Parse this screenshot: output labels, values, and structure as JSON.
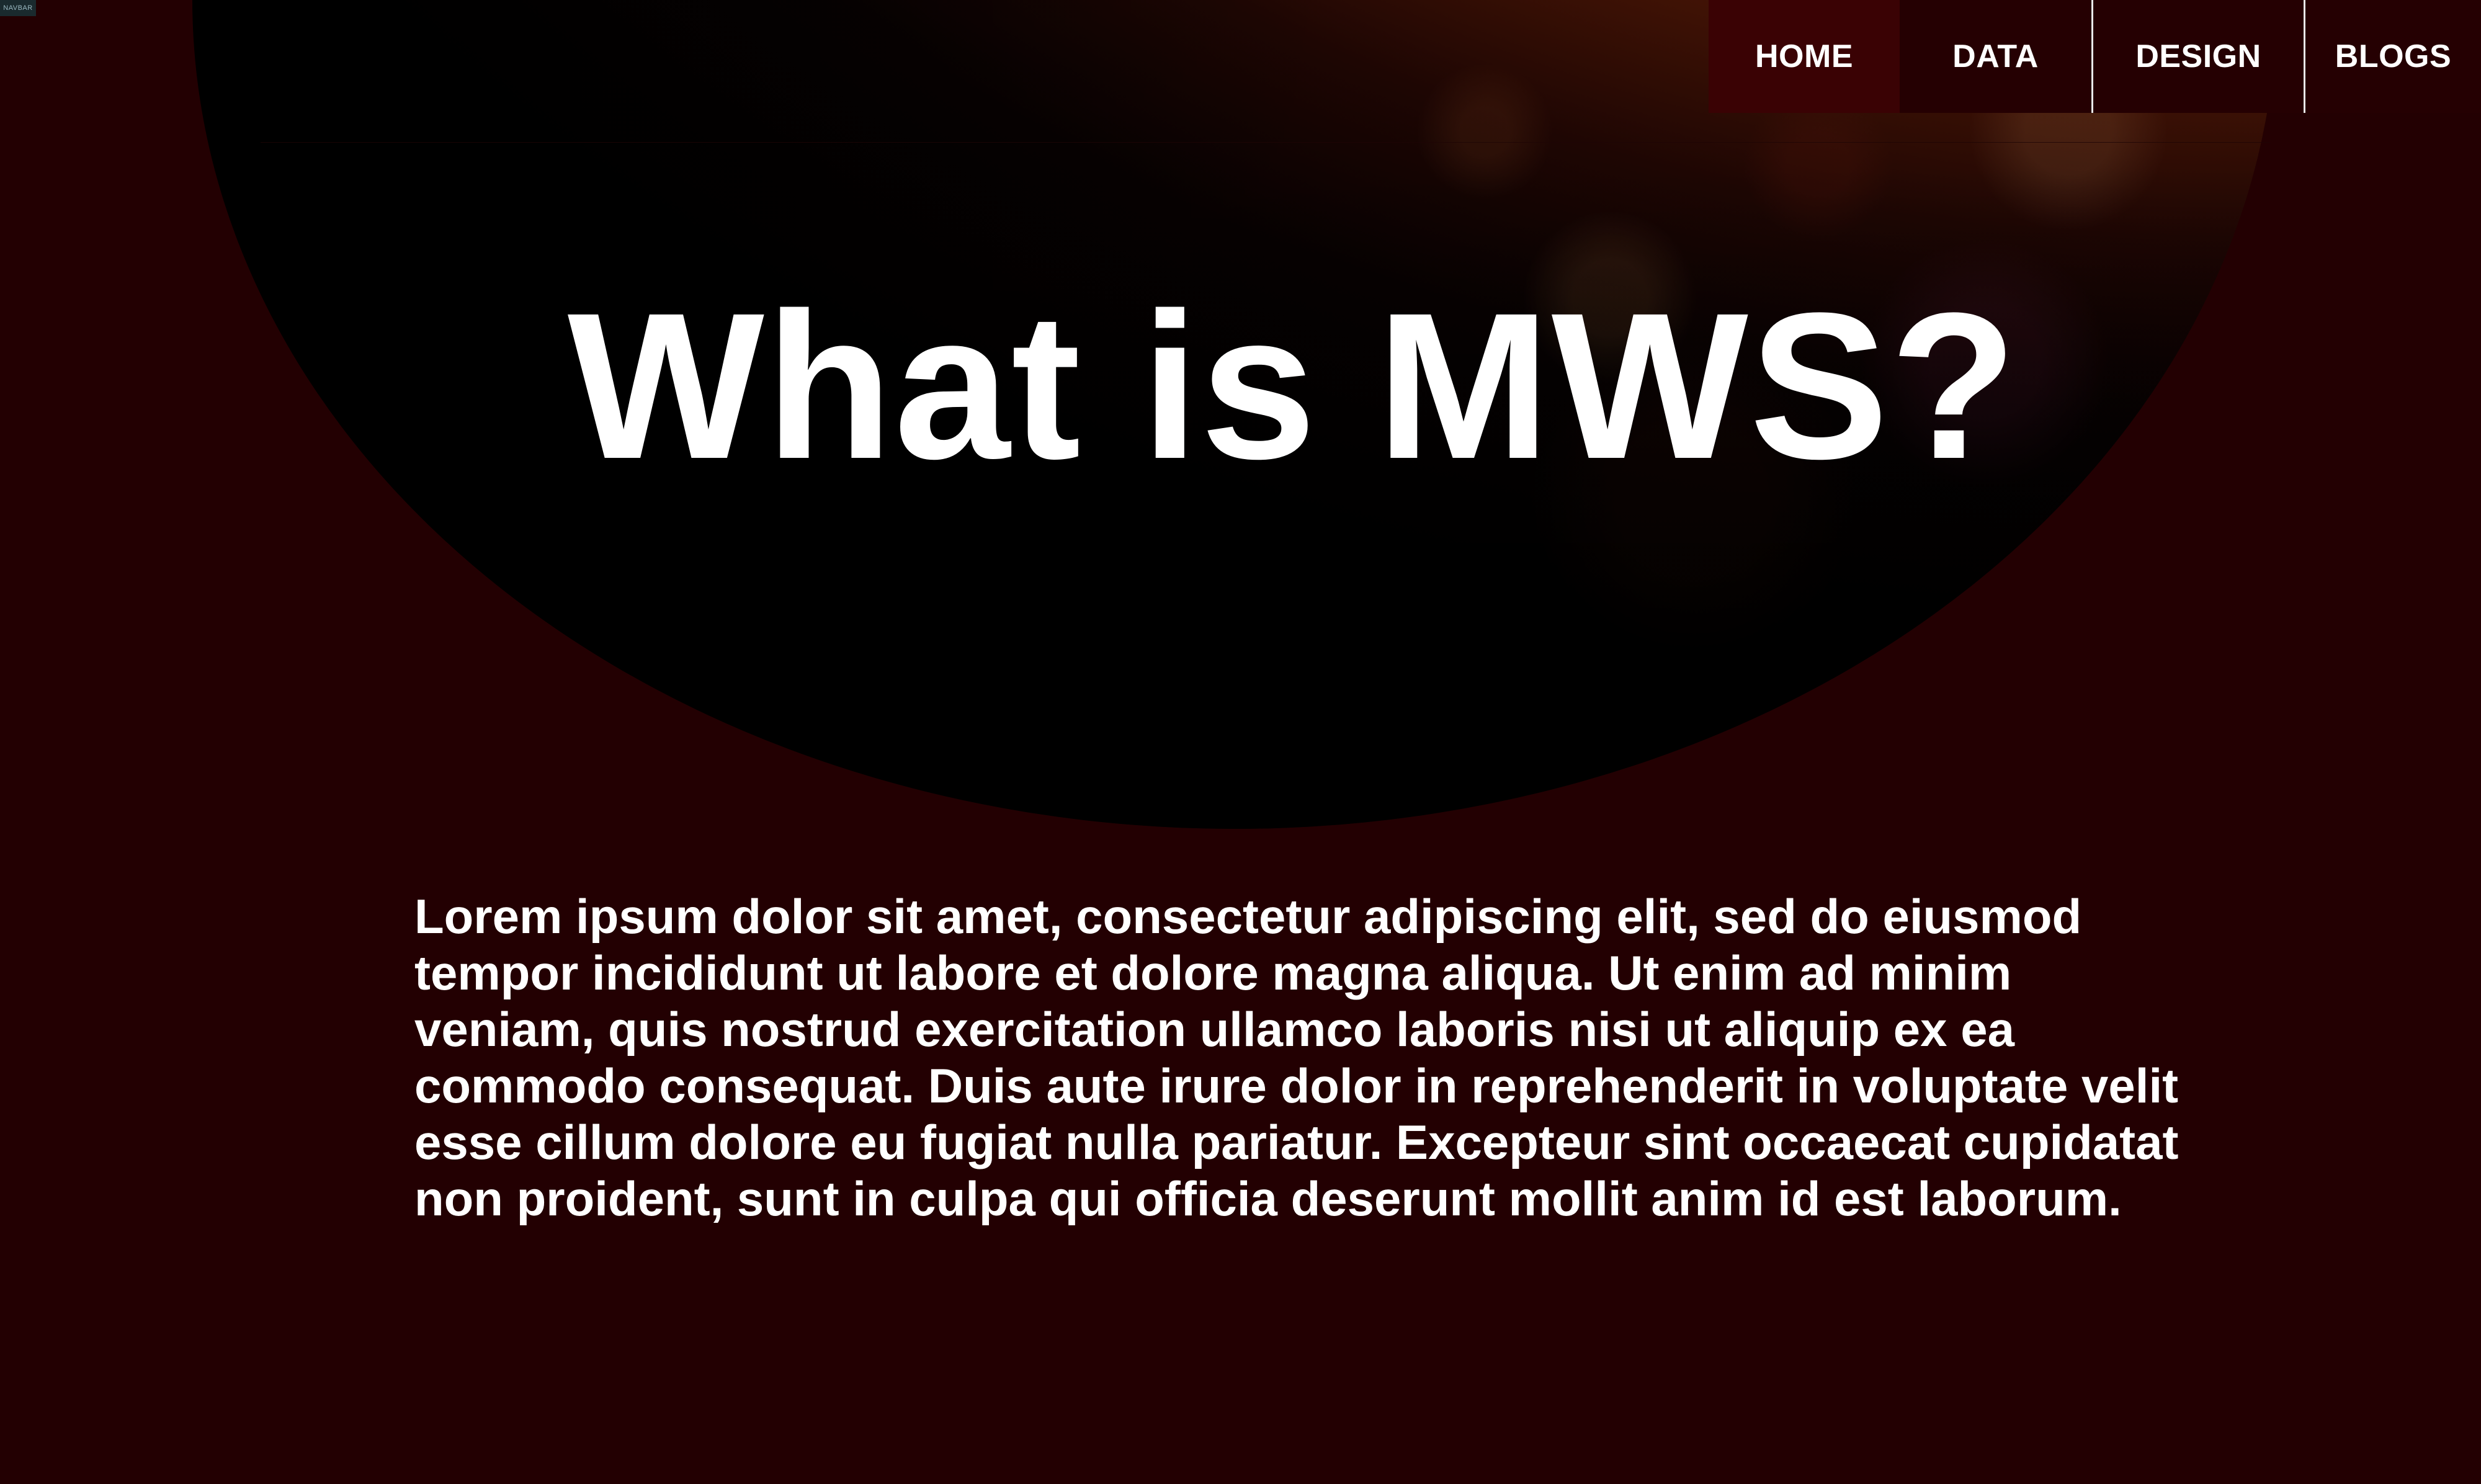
{
  "navbar": {
    "tag": "NAVBAR",
    "items": [
      {
        "label": "HOME"
      },
      {
        "label": "DATA"
      },
      {
        "label": "DESIGN"
      },
      {
        "label": "BLOGS"
      }
    ]
  },
  "hero": {
    "title": "What is MWS?",
    "image": "mars-planet"
  },
  "intro": {
    "text": "Lorem ipsum dolor sit amet, consectetur adipiscing elit, sed do eiusmod tempor incididunt ut labore et dolore magna aliqua. Ut enim ad minim veniam, quis nostrud exercitation ullamco laboris nisi ut aliquip ex ea commodo consequat. Duis aute irure dolor in reprehenderit in voluptate velit esse cillum dolore eu fugiat nulla pariatur. Excepteur sint occaecat cupidatat non proident, sunt in culpa qui officia deserunt mollit anim id est laborum."
  },
  "colors": {
    "background": "#230002",
    "nav_active": "#3a0204",
    "text": "#ffffff",
    "planet_highlight": "#e56a22"
  }
}
